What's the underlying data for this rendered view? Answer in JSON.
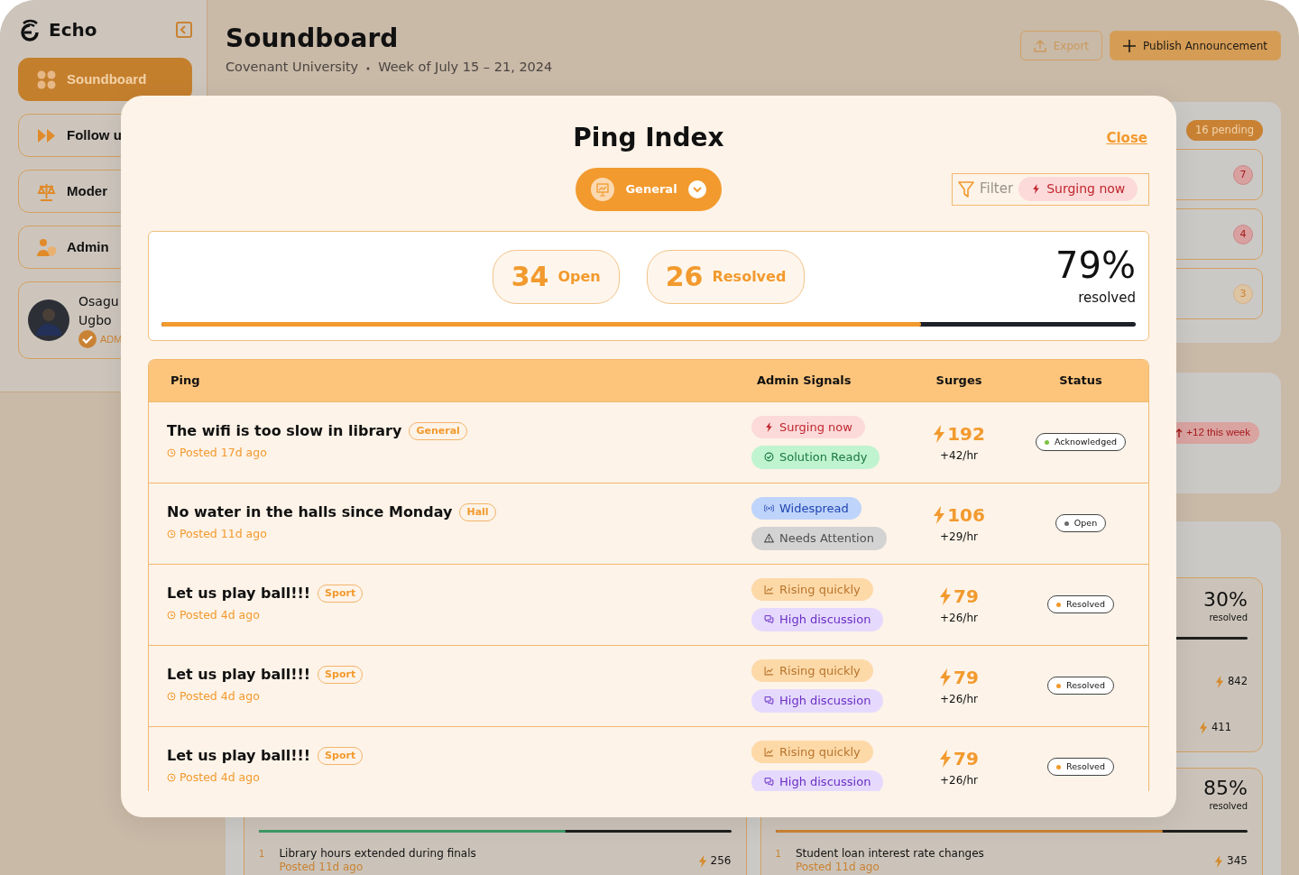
{
  "sidebar": {
    "brand": "Echo",
    "items": [
      {
        "label": "Soundboard",
        "selected": true
      },
      {
        "label": "Follow u",
        "selected": false
      },
      {
        "label": "Moder",
        "selected": false
      },
      {
        "label": "Admin",
        "selected": false
      }
    ],
    "profile": {
      "name_lines": [
        "Osagu",
        "Ugbo"
      ],
      "role": "ADM"
    }
  },
  "header": {
    "title": "Soundboard",
    "org": "Covenant University",
    "week": "Week of July 15 – 21, 2024",
    "buttons": [
      {
        "label": "Export",
        "kind": "outline"
      },
      {
        "label": "Publish Announcement",
        "kind": "primary"
      }
    ]
  },
  "pending_panel": {
    "badge": "16 pending",
    "items": [
      {
        "count": "7",
        "kind": "red"
      },
      {
        "count": "4",
        "kind": "red"
      },
      {
        "count": "3",
        "kind": "orange"
      }
    ]
  },
  "trend_panel": {
    "badge": "+12 this week"
  },
  "category_cards": [
    {
      "percent": "30%",
      "caption": "resolved",
      "items": [
        {
          "surges": "842"
        },
        {
          "surges": "411"
        }
      ]
    },
    {
      "level": 0.65,
      "color": "#3f9a68",
      "items": [
        {
          "rank": "1",
          "title": "Library hours extended during finals",
          "posted": "Posted 11d ago",
          "surges": "256"
        }
      ]
    },
    {
      "percent": "85%",
      "caption": "resolved",
      "level": 0.82,
      "color": "#c98233",
      "items": [
        {
          "rank": "1",
          "title": "Student loan interest rate changes",
          "posted": "Posted 11d ago",
          "surges": "345"
        }
      ]
    }
  ],
  "modal": {
    "title": "Ping Index",
    "close": "Close",
    "category": "General",
    "filter": {
      "label": "Filter",
      "chip": {
        "label": "Surging now",
        "kind": "surging"
      }
    },
    "stats": {
      "open_count": "34",
      "open_label": "Open",
      "resolved_count": "26",
      "resolved_label": "Resolved",
      "percent": "79%",
      "caption": "resolved",
      "level": 0.78
    },
    "table": {
      "columns": [
        "Ping",
        "Admin Signals",
        "Surges",
        "Status"
      ],
      "rows": [
        {
          "title": "The wifi is too slow in library",
          "tag": "General",
          "posted": "Posted 17d ago",
          "signals": [
            {
              "label": "Surging now",
              "kind": "surging"
            },
            {
              "label": "Solution Ready",
              "kind": "solution"
            }
          ],
          "surges": "192",
          "rate": "+42/hr",
          "status": {
            "label": "Acknowledged",
            "color": "#7cc242"
          }
        },
        {
          "title": "No water in the halls since Monday",
          "tag": "Hall",
          "posted": "Posted 11d ago",
          "signals": [
            {
              "label": "Widespread",
              "kind": "widespread"
            },
            {
              "label": "Needs Attention",
              "kind": "attention"
            }
          ],
          "surges": "106",
          "rate": "+29/hr",
          "status": {
            "label": "Open",
            "color": "#6b6b6b"
          }
        },
        {
          "title": "Let us play ball!!!",
          "tag": "Sport",
          "posted": "Posted 4d ago",
          "signals": [
            {
              "label": "Rising quickly",
              "kind": "rising"
            },
            {
              "label": "High discussion",
              "kind": "discussion"
            }
          ],
          "surges": "79",
          "rate": "+26/hr",
          "status": {
            "label": "Resolved",
            "color": "#f29a2e"
          }
        },
        {
          "title": "Let us play ball!!!",
          "tag": "Sport",
          "posted": "Posted 4d ago",
          "signals": [
            {
              "label": "Rising quickly",
              "kind": "rising"
            },
            {
              "label": "High discussion",
              "kind": "discussion"
            }
          ],
          "surges": "79",
          "rate": "+26/hr",
          "status": {
            "label": "Resolved",
            "color": "#f29a2e"
          }
        },
        {
          "title": "Let us play ball!!!",
          "tag": "Sport",
          "posted": "Posted 4d ago",
          "signals": [
            {
              "label": "Rising quickly",
              "kind": "rising"
            },
            {
              "label": "High discussion",
              "kind": "discussion"
            }
          ],
          "surges": "79",
          "rate": "+26/hr",
          "status": {
            "label": "Resolved",
            "color": "#f29a2e"
          }
        }
      ]
    }
  }
}
